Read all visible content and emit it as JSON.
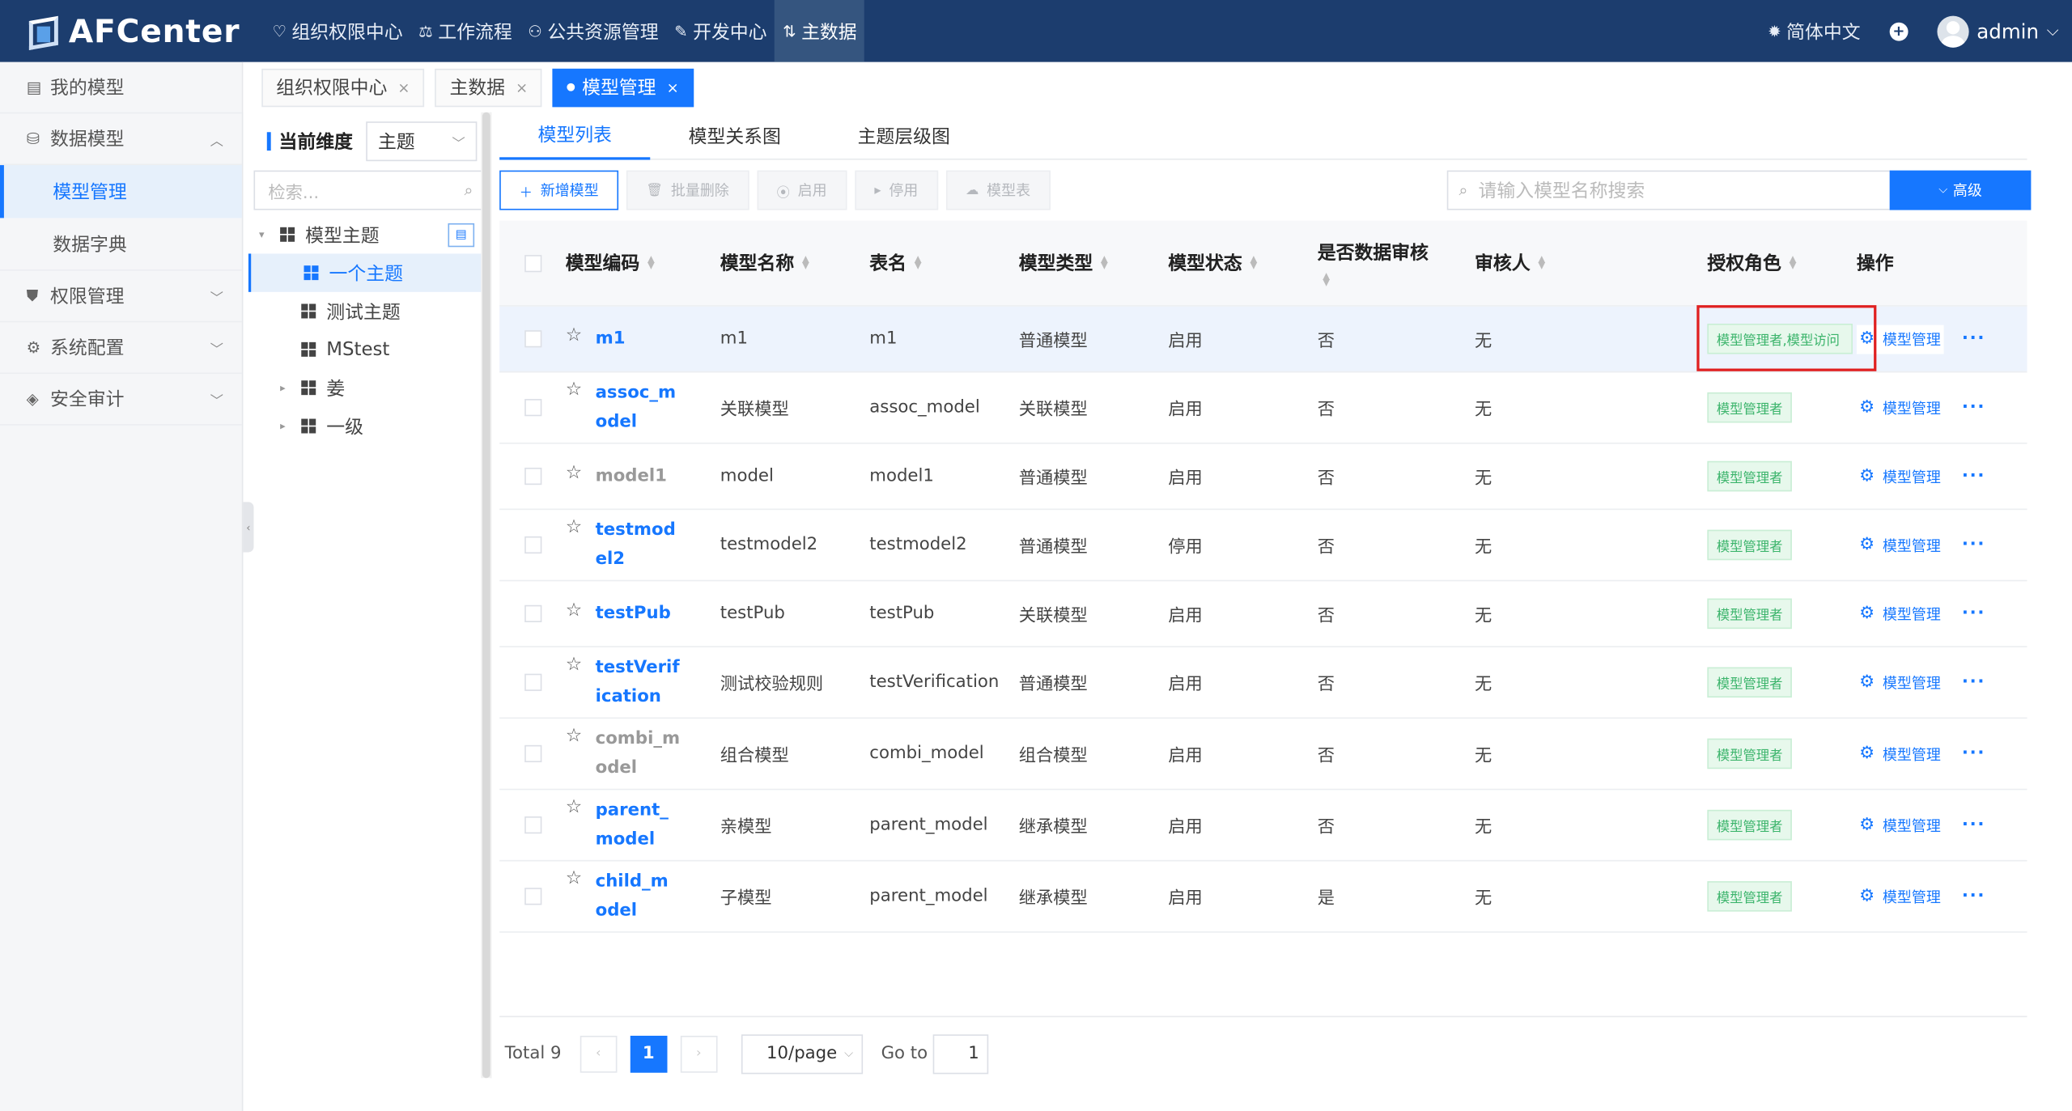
{
  "app": {
    "title": "AFCenter",
    "logo_icon": "afcenter-logo"
  },
  "nav": [
    {
      "label": "组织权限中心",
      "icon": "shield-icon"
    },
    {
      "label": "工作流程",
      "icon": "flow-icon"
    },
    {
      "label": "公共资源管理",
      "icon": "people-icon"
    },
    {
      "label": "开发中心",
      "icon": "edit-icon"
    },
    {
      "label": "主数据",
      "icon": "data-icon",
      "active": true
    }
  ],
  "header": {
    "lang": "简体中文",
    "user": "admin"
  },
  "sidebar": {
    "items": [
      {
        "label": "我的模型",
        "icon": "model-icon"
      },
      {
        "label": "数据模型",
        "icon": "database-icon",
        "expanded": true
      },
      {
        "label": "权限管理",
        "icon": "shield-icon"
      },
      {
        "label": "系统配置",
        "icon": "gear-icon"
      },
      {
        "label": "安全审计",
        "icon": "audit-icon"
      }
    ],
    "subitems": [
      {
        "label": "模型管理",
        "active": true
      },
      {
        "label": "数据字典"
      }
    ]
  },
  "tabs": [
    {
      "label": "组织权限中心",
      "close": "×"
    },
    {
      "label": "主数据",
      "close": "×"
    },
    {
      "label": "模型管理",
      "close": "×",
      "active": true
    }
  ],
  "tree": {
    "dimension_label": "当前维度",
    "dimension_value": "主题",
    "search_placeholder": "检索...",
    "nodes": [
      {
        "label": "模型主题",
        "expand": "▾",
        "level": 0
      },
      {
        "label": "一个主题",
        "level": 1,
        "selected": true
      },
      {
        "label": "测试主题",
        "level": 1
      },
      {
        "label": "MStest",
        "level": 1
      },
      {
        "label": "姜",
        "expand": "▸",
        "level": 1
      },
      {
        "label": "一级",
        "expand": "▸",
        "level": 1
      }
    ]
  },
  "subtabs": [
    "模型列表",
    "模型关系图",
    "主题层级图"
  ],
  "toolbar": {
    "add": "新增模型",
    "batch_delete": "批量删除",
    "enable": "启用",
    "disable": "停用",
    "model_table": "模型表",
    "search_placeholder": "请输入模型名称搜索",
    "advanced": "高级"
  },
  "table": {
    "headers": {
      "code": "模型编码",
      "name": "模型名称",
      "table": "表名",
      "type": "模型类型",
      "status": "模型状态",
      "audit": "是否数据审核",
      "auditor": "审核人",
      "role": "授权角色",
      "ops": "操作"
    },
    "op_label": "模型管理",
    "more": "···",
    "rows": [
      {
        "code": "m1",
        "name": "m1",
        "table": "m1",
        "type": "普通模型",
        "status": "启用",
        "audit": "否",
        "auditor": "无",
        "role": "模型管理者,模型访问",
        "gray": false
      },
      {
        "code": "assoc_model",
        "name": "关联模型",
        "table": "assoc_model",
        "type": "关联模型",
        "status": "启用",
        "audit": "否",
        "auditor": "无",
        "role": "模型管理者",
        "gray": false
      },
      {
        "code": "model1",
        "name": "model",
        "table": "model1",
        "type": "普通模型",
        "status": "启用",
        "audit": "否",
        "auditor": "无",
        "role": "模型管理者",
        "gray": true
      },
      {
        "code": "testmodel2",
        "name": "testmodel2",
        "table": "testmodel2",
        "type": "普通模型",
        "status": "停用",
        "audit": "否",
        "auditor": "无",
        "role": "模型管理者",
        "gray": false
      },
      {
        "code": "testPub",
        "name": "testPub",
        "table": "testPub",
        "type": "关联模型",
        "status": "启用",
        "audit": "否",
        "auditor": "无",
        "role": "模型管理者",
        "gray": false
      },
      {
        "code": "testVerification",
        "name": "测试校验规则",
        "table": "testVerification",
        "type": "普通模型",
        "status": "启用",
        "audit": "否",
        "auditor": "无",
        "role": "模型管理者",
        "gray": false
      },
      {
        "code": "combi_model",
        "name": "组合模型",
        "table": "combi_model",
        "type": "组合模型",
        "status": "启用",
        "audit": "否",
        "auditor": "无",
        "role": "模型管理者",
        "gray": true
      },
      {
        "code": "parent_model",
        "name": "亲模型",
        "table": "parent_model",
        "type": "继承模型",
        "status": "启用",
        "audit": "否",
        "auditor": "无",
        "role": "模型管理者",
        "gray": false
      },
      {
        "code": "child_model",
        "name": "子模型",
        "table": "parent_model",
        "type": "继承模型",
        "status": "启用",
        "audit": "是",
        "auditor": "无",
        "role": "模型管理者",
        "gray": false
      }
    ]
  },
  "pager": {
    "total": "Total 9",
    "current": "1",
    "size": "10/page",
    "goto_label": "Go to",
    "goto_value": "1"
  }
}
